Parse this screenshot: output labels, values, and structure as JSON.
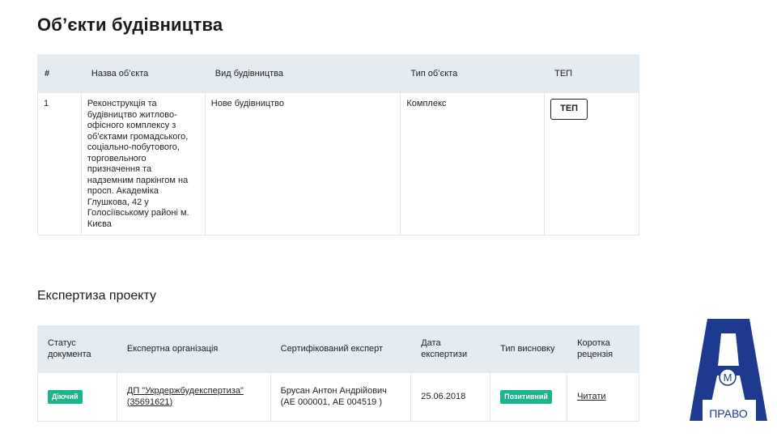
{
  "objects_section": {
    "title": "Об’єкти будівництва",
    "columns": [
      "#",
      "Назва об’єкта",
      "Вид будівництва",
      "Тип об’єкта",
      "ТЕП"
    ],
    "rows": [
      {
        "num": "1",
        "name": "Реконструкція та будівництво житлово-офісного комплексу з об'єктами громадського, соціально-побутового, торговельного призначення та надземним паркінгом на просп. Академіка Глушкова, 42 у Голосіївському районі м. Києва",
        "construction_type": "Нове будівництво",
        "object_type": "Комплекс",
        "tep_button": "ТЕП"
      }
    ]
  },
  "expertise_section": {
    "title": "Експертиза проекту",
    "columns": [
      "Статус документа",
      "Експертна організація",
      "Сертифікований експерт",
      "Дата експертизи",
      "Тип висновку",
      "Коротка рецензія"
    ],
    "rows": [
      {
        "status": "Діючий",
        "organization": "ДП \"Укрдержбудекспертиза\" (35691621)",
        "expert": "Брусан Антон Андрійович (АЕ 000001, АЕ 004519 )",
        "date": "25.06.2018",
        "conclusion_type": "Позитивний",
        "review_link": "Читати"
      }
    ]
  },
  "logo": {
    "letter_mark": "М",
    "caption": "ПРАВО"
  },
  "colors": {
    "header_bg": "#e4ebf1",
    "badge_green": "#1cb48a",
    "logo_blue": "#1e3a8f"
  }
}
